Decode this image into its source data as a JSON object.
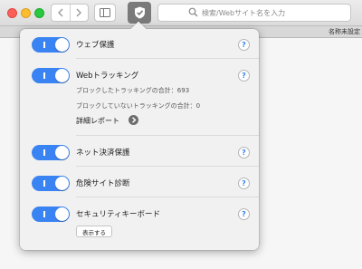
{
  "toolbar": {
    "search_placeholder": "検索/Webサイト名を入力",
    "tab_title": "名称未設定"
  },
  "popover": {
    "items": [
      {
        "label": "ウェブ保護",
        "enabled": true,
        "help": "?"
      },
      {
        "label": "Webトラッキング",
        "enabled": true,
        "help": "?",
        "blocked_text": "ブロックしたトラッキングの合計：693",
        "unblocked_text": "ブロックしていないトラッキングの合計：0",
        "report_label": "詳細レポート"
      },
      {
        "label": "ネット決済保護",
        "enabled": true,
        "help": "?"
      },
      {
        "label": "危険サイト診断",
        "enabled": true,
        "help": "?"
      },
      {
        "label": "セキュリティキーボード",
        "enabled": true,
        "help": "?",
        "show_button": "表示する"
      }
    ]
  },
  "colors": {
    "toggle_on": "#3a83f2",
    "help_icon": "#3a83f2"
  },
  "icons": {
    "back": "chevron-left-icon",
    "forward": "chevron-right-icon",
    "sidebar": "sidebar-icon",
    "extension": "shield-icon",
    "search": "search-icon",
    "report_arrow": "chevron-right-circle-icon"
  }
}
